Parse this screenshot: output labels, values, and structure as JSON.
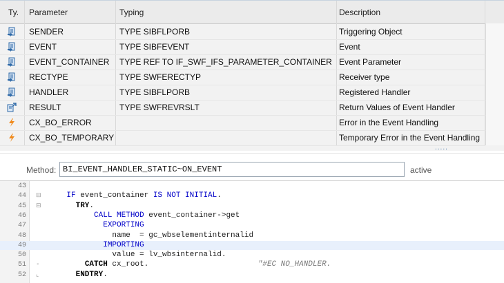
{
  "table": {
    "headers": {
      "type": "Ty.",
      "parameter": "Parameter",
      "typing": "Typing",
      "description": "Description"
    },
    "rows": [
      {
        "icon": "importing-param-icon",
        "parameter": "SENDER",
        "typing": "TYPE SIBFLPORB",
        "description": "Triggering Object"
      },
      {
        "icon": "importing-param-icon",
        "parameter": "EVENT",
        "typing": "TYPE SIBFEVENT",
        "description": "Event"
      },
      {
        "icon": "importing-param-icon",
        "parameter": "EVENT_CONTAINER",
        "typing": "TYPE REF TO IF_SWF_IFS_PARAMETER_CONTAINER",
        "description": "Event Parameter"
      },
      {
        "icon": "importing-param-icon",
        "parameter": "RECTYPE",
        "typing": "TYPE SWFERECTYP",
        "description": "Receiver type"
      },
      {
        "icon": "importing-param-icon",
        "parameter": "HANDLER",
        "typing": "TYPE SIBFLPORB",
        "description": "Registered Handler"
      },
      {
        "icon": "exporting-param-icon",
        "parameter": "RESULT",
        "typing": "TYPE SWFREVRSLT",
        "description": "Return Values of Event Handler"
      },
      {
        "icon": "exception-icon",
        "parameter": "CX_BO_ERROR",
        "typing": "",
        "description": "Error in the Event Handling"
      },
      {
        "icon": "exception-icon",
        "parameter": "CX_BO_TEMPORARY",
        "typing": "",
        "description": "Temporary Error in the Event Handling"
      }
    ],
    "more_indicator": "....."
  },
  "method": {
    "label": "Method:",
    "value": "BI_EVENT_HANDLER_STATIC~ON_EVENT",
    "status": "active"
  },
  "code": {
    "lines": [
      {
        "no": "43",
        "segments": []
      },
      {
        "no": "44",
        "segments": [
          {
            "t": "    ",
            "c": ""
          },
          {
            "t": "IF",
            "c": "kw"
          },
          {
            "t": " event_container ",
            "c": ""
          },
          {
            "t": "IS NOT INITIAL",
            "c": "kw"
          },
          {
            "t": ".",
            "c": ""
          }
        ]
      },
      {
        "no": "45",
        "segments": [
          {
            "t": "      ",
            "c": ""
          },
          {
            "t": "TRY",
            "c": "kwb"
          },
          {
            "t": ".",
            "c": ""
          }
        ]
      },
      {
        "no": "46",
        "segments": [
          {
            "t": "          ",
            "c": ""
          },
          {
            "t": "CALL METHOD",
            "c": "kw"
          },
          {
            "t": " event_container->get",
            "c": ""
          }
        ]
      },
      {
        "no": "47",
        "segments": [
          {
            "t": "            ",
            "c": ""
          },
          {
            "t": "EXPORTING",
            "c": "kw"
          }
        ]
      },
      {
        "no": "48",
        "segments": [
          {
            "t": "              name  = gc_wbselementinternalid",
            "c": ""
          }
        ]
      },
      {
        "no": "49",
        "segments": [
          {
            "t": "            ",
            "c": ""
          },
          {
            "t": "IMPORTING",
            "c": "kw"
          }
        ]
      },
      {
        "no": "50",
        "segments": [
          {
            "t": "              value = lv_wbsinternalid.",
            "c": ""
          }
        ]
      },
      {
        "no": "51",
        "segments": [
          {
            "t": "        ",
            "c": ""
          },
          {
            "t": "CATCH",
            "c": "kwb"
          },
          {
            "t": " cx_root.                        ",
            "c": ""
          },
          {
            "t": "\"#EC NO_HANDLER.",
            "c": "cm"
          }
        ]
      },
      {
        "no": "52",
        "segments": [
          {
            "t": "      ",
            "c": ""
          },
          {
            "t": "ENDTRY",
            "c": "kwb"
          },
          {
            "t": ".",
            "c": ""
          }
        ]
      }
    ]
  }
}
